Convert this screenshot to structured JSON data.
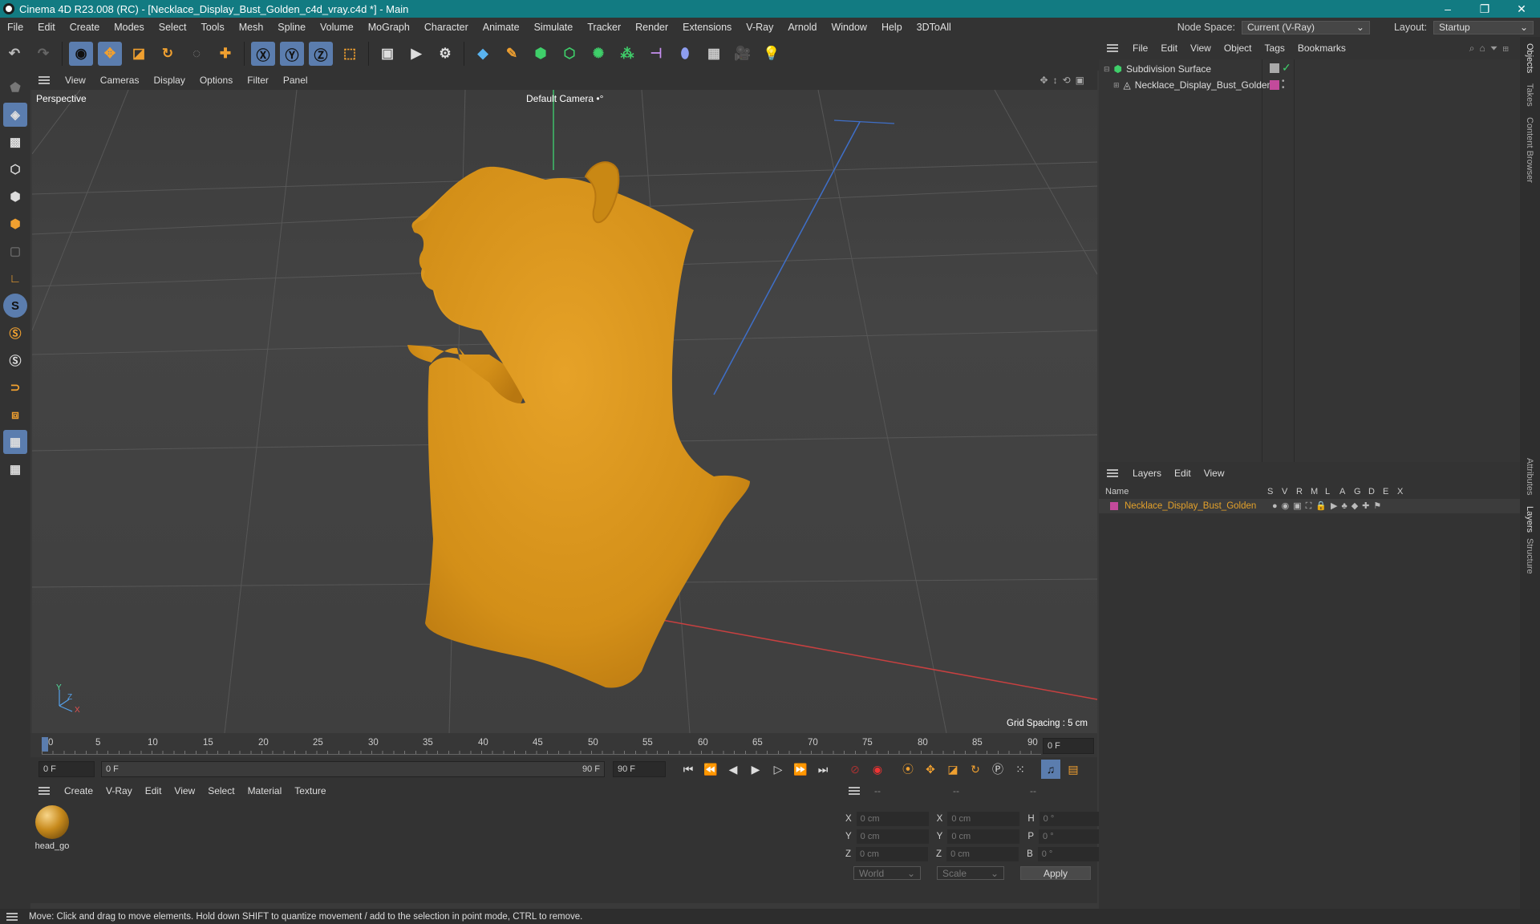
{
  "window": {
    "title": "Cinema 4D R23.008 (RC) - [Necklace_Display_Bust_Golden_c4d_vray.c4d *] - Main",
    "minimize": "–",
    "restore": "❐",
    "close": "✕"
  },
  "menu": {
    "items": [
      "File",
      "Edit",
      "Create",
      "Modes",
      "Select",
      "Tools",
      "Mesh",
      "Spline",
      "Volume",
      "MoGraph",
      "Character",
      "Animate",
      "Simulate",
      "Tracker",
      "Render",
      "Extensions",
      "V-Ray",
      "Arnold",
      "Window",
      "Help",
      "3DToAll"
    ],
    "node_space_label": "Node Space:",
    "node_space_value": "Current (V-Ray)",
    "layout_label": "Layout:",
    "layout_value": "Startup"
  },
  "viewport": {
    "menu": [
      "View",
      "Cameras",
      "Display",
      "Options",
      "Filter",
      "Panel"
    ],
    "name": "Perspective",
    "camera": "Default Camera",
    "camera_icon": "•°",
    "grid_spacing": "Grid Spacing : 5 cm",
    "axis_y": "Y",
    "axis_z": "Z",
    "axis_x": "X"
  },
  "timeline": {
    "ticks": [
      "0",
      "5",
      "10",
      "15",
      "20",
      "25",
      "30",
      "35",
      "40",
      "45",
      "50",
      "55",
      "60",
      "65",
      "70",
      "75",
      "80",
      "85",
      "90"
    ],
    "frame_right": "0 F"
  },
  "playback": {
    "start": "0 F",
    "range_start": "0 F",
    "range_end": "90 F",
    "end": "90 F"
  },
  "material_manager": {
    "menu": [
      "Create",
      "V-Ray",
      "Edit",
      "View",
      "Select",
      "Material",
      "Texture"
    ],
    "material_name": "head_go"
  },
  "coordinates": {
    "header": [
      "--",
      "--",
      "--"
    ],
    "rows": [
      {
        "a": "X",
        "av": "0 cm",
        "b": "X",
        "bv": "0 cm",
        "c": "H",
        "cv": "0 °"
      },
      {
        "a": "Y",
        "av": "0 cm",
        "b": "Y",
        "bv": "0 cm",
        "c": "P",
        "cv": "0 °"
      },
      {
        "a": "Z",
        "av": "0 cm",
        "b": "Z",
        "bv": "0 cm",
        "c": "B",
        "cv": "0 °"
      }
    ],
    "mode1": "World",
    "mode2": "Scale",
    "apply": "Apply"
  },
  "objects": {
    "menu": [
      "File",
      "Edit",
      "View",
      "Object",
      "Tags",
      "Bookmarks"
    ],
    "items": [
      "Subdivision Surface",
      "Necklace_Display_Bust_Golden"
    ],
    "check": "✓"
  },
  "layers": {
    "menu": [
      "Layers",
      "Edit",
      "View"
    ],
    "columns": [
      "Name",
      "S",
      "V",
      "R",
      "M",
      "L",
      "A",
      "G",
      "D",
      "E",
      "X"
    ],
    "item": "Necklace_Display_Bust_Golden"
  },
  "side_tabs": {
    "top": [
      "Objects",
      "Takes",
      "Content Browser"
    ],
    "bottom": [
      "Attributes",
      "Layers",
      "Structure"
    ]
  },
  "status": "Move: Click and drag to move elements. Hold down SHIFT to quantize movement / add to the selection in point mode, CTRL to remove.",
  "colors": {
    "accent": "#127b82",
    "object": "#e4a12a",
    "layer": "#c34a9b"
  }
}
